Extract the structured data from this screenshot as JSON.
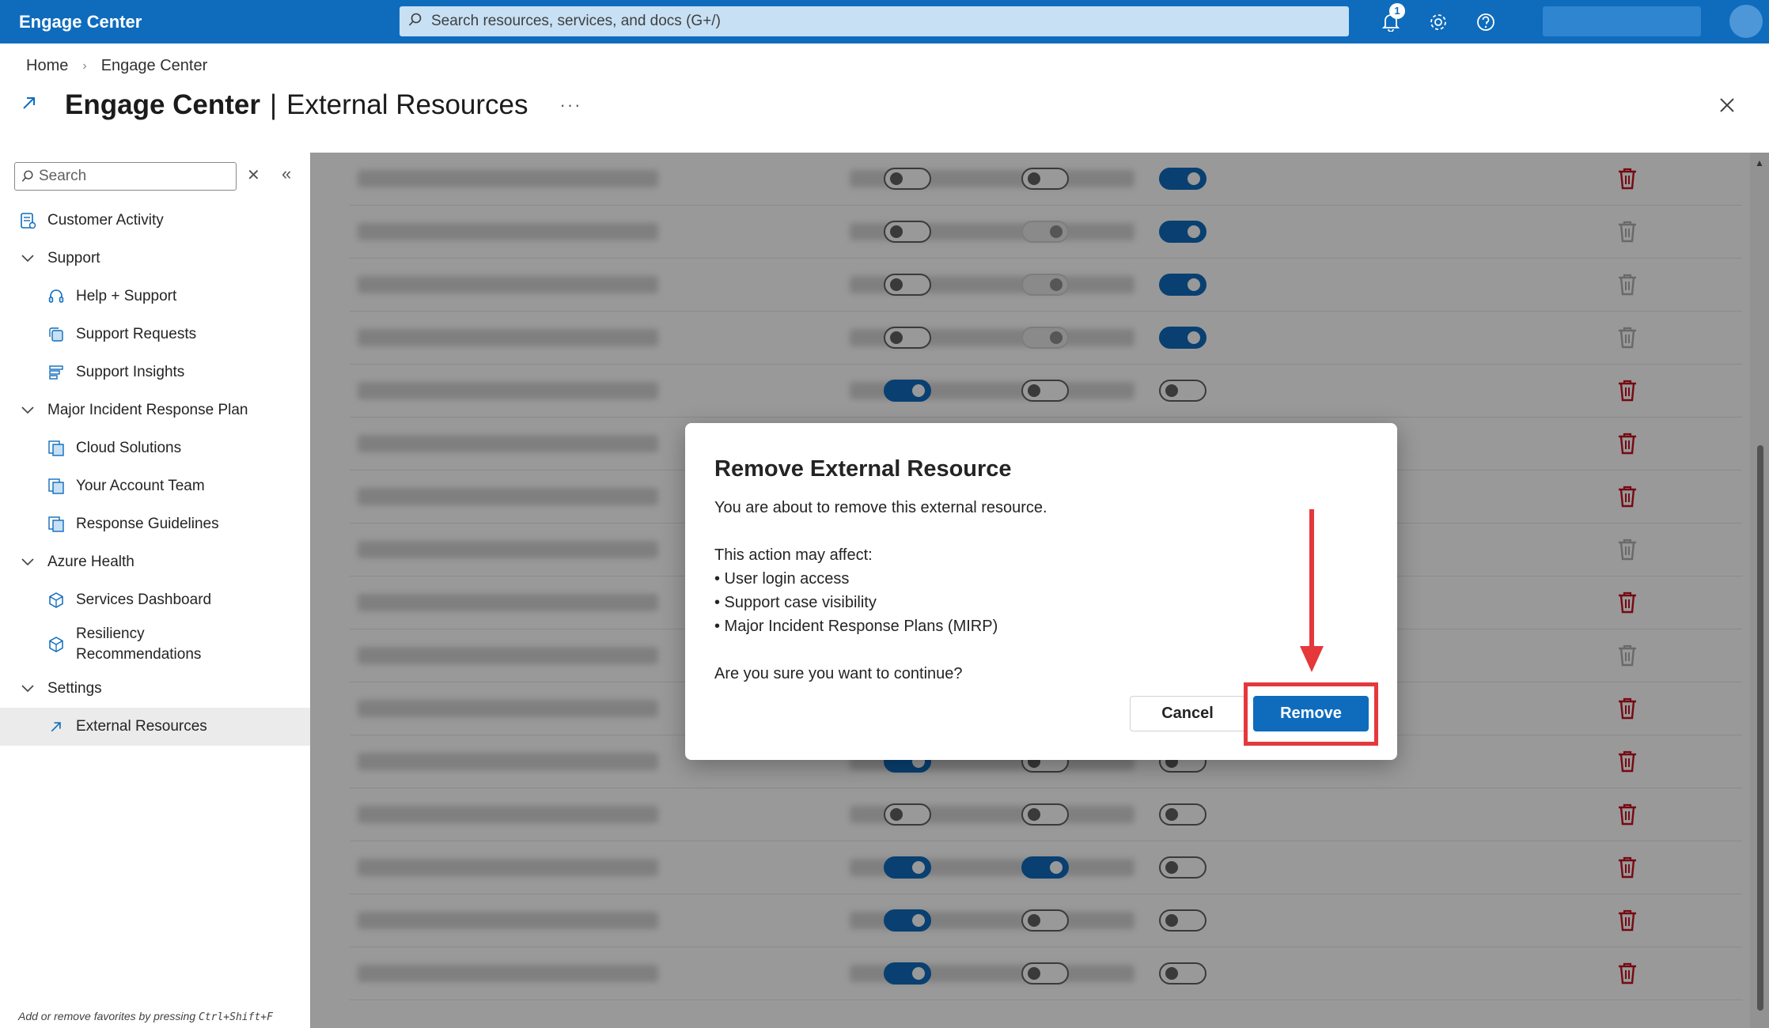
{
  "topbar": {
    "brand": "Engage Center",
    "search_placeholder": "Search resources, services, and docs (G+/)",
    "notification_count": "1",
    "accent": "#0f6cbd"
  },
  "breadcrumb": {
    "home": "Home",
    "current": "Engage Center"
  },
  "header": {
    "title_strong": "Engage Center",
    "separator": "|",
    "title_sub": "External Resources",
    "more": "···"
  },
  "sidebar": {
    "search_placeholder": "Search",
    "items": [
      {
        "label": "Customer Activity",
        "icon": "customer-activity-icon",
        "level": 0
      },
      {
        "label": "Support",
        "icon": "chevron-down-icon",
        "level": 0
      },
      {
        "label": "Help + Support",
        "icon": "headset-icon",
        "level": 1
      },
      {
        "label": "Support Requests",
        "icon": "support-requests-icon",
        "level": 1
      },
      {
        "label": "Support Insights",
        "icon": "insights-icon",
        "level": 1
      },
      {
        "label": "Major Incident Response Plan",
        "icon": "chevron-down-icon",
        "level": 0
      },
      {
        "label": "Cloud Solutions",
        "icon": "document-icon",
        "level": 1
      },
      {
        "label": "Your Account Team",
        "icon": "document-icon",
        "level": 1
      },
      {
        "label": "Response Guidelines",
        "icon": "document-icon",
        "level": 1
      },
      {
        "label": "Azure Health",
        "icon": "chevron-down-icon",
        "level": 0
      },
      {
        "label": "Services Dashboard",
        "icon": "cube-icon",
        "level": 1
      },
      {
        "label": "Resiliency Recommendations",
        "line1": "Resiliency",
        "line2": "Recommendations",
        "icon": "cube-icon",
        "level": 1
      },
      {
        "label": "Settings",
        "icon": "chevron-down-icon",
        "level": 0
      },
      {
        "label": "External Resources",
        "icon": "external-link-icon",
        "level": 1,
        "selected": true
      }
    ],
    "footer_text": "Add or remove favorites by pressing ",
    "footer_kbd": "Ctrl+Shift+F"
  },
  "grid": {
    "rows": [
      {
        "c1": "off",
        "c2": "off",
        "c3": "on",
        "del": true
      },
      {
        "c1": "off",
        "c2": "disabled",
        "c3": "on",
        "del": false
      },
      {
        "c1": "off",
        "c2": "disabled",
        "c3": "on",
        "del": false
      },
      {
        "c1": "off",
        "c2": "disabled",
        "c3": "on",
        "del": false
      },
      {
        "c1": "on",
        "c2": "off",
        "c3": "off",
        "del": true
      },
      {
        "c1": "on",
        "c2": "on",
        "c3": "off",
        "del": true
      },
      {
        "c1": "on",
        "c2": "off",
        "c3": "off",
        "del": true
      },
      {
        "c1": "off",
        "c2": "off",
        "c3": "off",
        "del": false
      },
      {
        "c1": "on",
        "c2": "off",
        "c3": "off",
        "del": true
      },
      {
        "c1": "off",
        "c2": "disabled",
        "c3": "on",
        "del": false
      },
      {
        "c1": "on",
        "c2": "off",
        "c3": "off",
        "del": true
      },
      {
        "c1": "on",
        "c2": "off",
        "c3": "off",
        "del": true
      },
      {
        "c1": "off",
        "c2": "off",
        "c3": "off",
        "del": true
      },
      {
        "c1": "on",
        "c2": "on",
        "c3": "off",
        "del": true
      },
      {
        "c1": "on",
        "c2": "off",
        "c3": "off",
        "del": true
      },
      {
        "c1": "on",
        "c2": "off",
        "c3": "off",
        "del": true
      }
    ]
  },
  "dialog": {
    "title": "Remove External Resource",
    "intro": "You are about to remove this external resource.",
    "affect_heading": "This action may affect:",
    "affects": [
      "• User login access",
      "• Support case visibility",
      "• Major Incident Response Plans (MIRP)"
    ],
    "question": "Are you sure you want to continue?",
    "cancel_label": "Cancel",
    "remove_label": "Remove",
    "highlight_color": "#e5383b"
  }
}
